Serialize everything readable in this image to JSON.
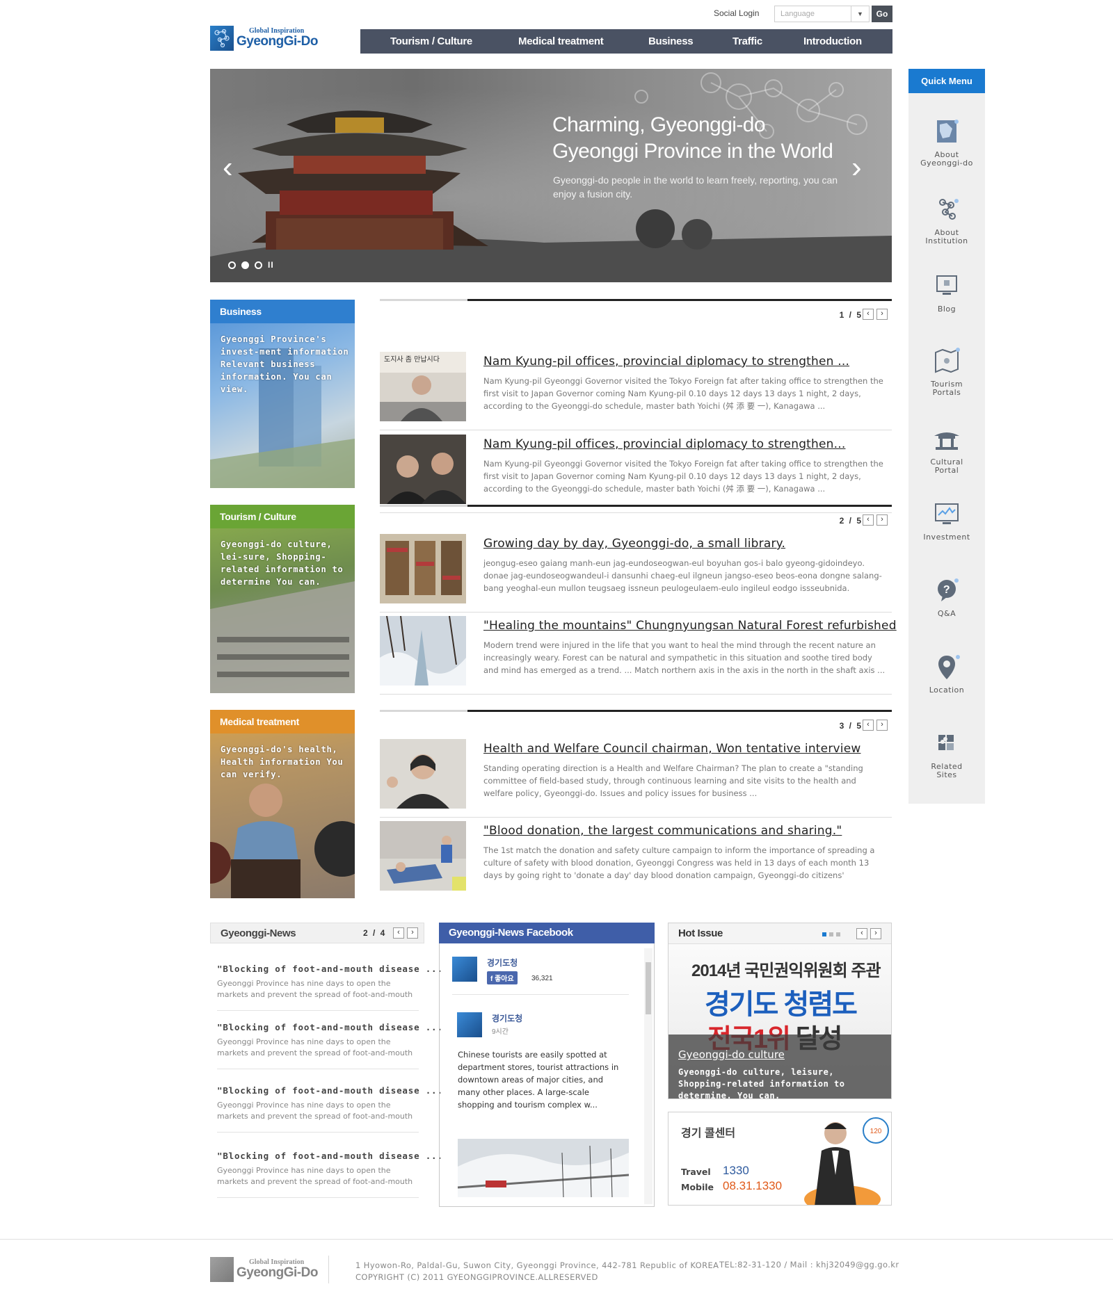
{
  "header": {
    "social_login": "Social Login",
    "language_placeholder": "Language",
    "go_label": "Go",
    "logo_tagline": "Global Inspiration",
    "logo_name": "GyeongGi-Do",
    "nav": [
      "Tourism / Culture",
      "Medical treatment",
      "Business",
      "Traffic",
      "Introduction"
    ]
  },
  "hero": {
    "title_line1": "Charming, Gyeonggi-do",
    "title_line2": "Gyeonggi Province in the World",
    "desc": "Gyeonggi-do people in the world to learn freely, reporting, you can enjoy a fusion city.",
    "slides": 3,
    "active_slide": 2,
    "prev_icon": "chevron-left-icon",
    "next_icon": "chevron-right-icon"
  },
  "quick_menu": {
    "title": "Quick Menu",
    "items": [
      {
        "label1": "About",
        "label2": "Gyeonggi-do",
        "icon": "map-icon"
      },
      {
        "label1": "About",
        "label2": "Institution",
        "icon": "institution-icon"
      },
      {
        "label1": "Blog",
        "label2": "",
        "icon": "monitor-icon"
      },
      {
        "label1": "Tourism",
        "label2": "Portals",
        "icon": "tourism-map-icon"
      },
      {
        "label1": "Cultural",
        "label2": "Portal",
        "icon": "palace-icon"
      },
      {
        "label1": "Investment",
        "label2": "",
        "icon": "chart-monitor-icon"
      },
      {
        "label1": "Q&A",
        "label2": "",
        "icon": "question-bubble-icon"
      },
      {
        "label1": "Location",
        "label2": "",
        "icon": "location-pin-icon"
      },
      {
        "label1": "Related",
        "label2": "Sites",
        "icon": "puzzle-icon"
      }
    ]
  },
  "categories": [
    {
      "title": "Business",
      "text": "Gyeonggi Province's invest-ment information Relevant business information. You can view.",
      "color": "#2f7fcf"
    },
    {
      "title": "Tourism / Culture",
      "text": "Gyeonggi-do culture, lei-sure, Shopping-related information to determine You can.",
      "color": "#5e9c2a"
    },
    {
      "title": "Medical treatment",
      "text": "Gyeonggi-do's health, Health information You can verify.",
      "color": "#e0902a"
    }
  ],
  "news_blocks": [
    {
      "page": "1 / 5",
      "articles": [
        {
          "title": "Nam Kyung-pil offices, provincial diplomacy to strengthen ...",
          "body": "Nam Kyung-pil Gyeonggi Governor visited the Tokyo Foreign fat after taking office to strengthen the first visit to Japan Governor coming Nam Kyung-pil 0.10 days 12 days 13 days 1 night, 2 days, according to the Gyeonggi-do schedule, master bath Yoichi (舛 添 要 一), Kanagawa ..."
        },
        {
          "title": "Nam Kyung-pil offices, provincial diplomacy to strengthen...",
          "body": "Nam Kyung-pil Gyeonggi Governor visited the Tokyo Foreign fat after taking office to strengthen the first visit to Japan Governor coming Nam Kyung-pil 0.10 days 12 days 13 days 1 night, 2 days, according to the Gyeonggi-do schedule, master bath Yoichi (舛 添 要 一), Kanagawa ..."
        }
      ]
    },
    {
      "page": "2 / 5",
      "articles": [
        {
          "title": "Growing day by day, Gyeonggi-do, a small library.",
          "body": "jeongug-eseo gaiang manh-eun jag-eundoseogwan-eul boyuhan gos-i balo gyeong-gidoindeyo. donae jag-eundoseogwandeul-i dansunhi chaeg-eul ilgneun jangso-eseo beos-eona dongne salang-bang yeoghal-eun mullon teugsaeg issneun peulogeulaem-eulo ingileul eodgo issseubnida. jeongug-"
        },
        {
          "title": "\"Healing the mountains\" Chungnyungsan Natural Forest refurbished",
          "body": "Modern trend were injured in the life that you want to heal the mind through the recent nature an increasingly weary. Forest can be natural and sympathetic in this situation and soothe tired body and mind has emerged as a trend. ... Match northern axis in the axis in the north in the shaft axis ... game"
        }
      ]
    },
    {
      "page": "3 / 5",
      "articles": [
        {
          "title": "Health and Welfare Council chairman, Won tentative interview",
          "body": "Standing operating direction is a Health and Welfare Chairman? The plan to create a \"standing committee of field-based study, through continuous learning and site visits to the health and welfare policy, Gyeonggi-do. Issues and policy issues for business ..."
        },
        {
          "title": "\"Blood donation, the largest communications and sharing.\"",
          "body": "The 1st match the donation and safety culture campaign to inform the importance of spreading a culture of safety with blood donation, Gyeonggi Congress was held in 13 days of each month 13 days by going right to 'donate a day' day blood donation campaign, Gyeonggi-do citizens' participation safety with"
        }
      ]
    }
  ],
  "gyeonggi_news": {
    "title": "Gyeonggi-News",
    "page": "2 / 4",
    "items": [
      {
        "title": "\"Blocking of foot-and-mouth disease ...",
        "l1": "Gyeonggi Province has nine days to open the",
        "l2": "markets and prevent the spread of foot-and-mouth"
      },
      {
        "title": "\"Blocking of foot-and-mouth disease ...",
        "l1": "Gyeonggi Province has nine days to open the",
        "l2": "markets and prevent the spread of foot-and-mouth"
      },
      {
        "title": "\"Blocking of foot-and-mouth disease ...",
        "l1": "Gyeonggi Province has nine days to open the",
        "l2": "markets and prevent the spread of foot-and-mouth"
      },
      {
        "title": "\"Blocking of foot-and-mouth disease ...",
        "l1": "Gyeonggi Province has nine days to open the",
        "l2": "markets and prevent the spread of foot-and-mouth"
      }
    ]
  },
  "facebook": {
    "title": "Gyeonggi-News Facebook",
    "page_name": "경기도청",
    "like_label": "좋아요",
    "like_count": "36,321",
    "post_author": "경기도청",
    "post_time": "9시간",
    "post_text": "Chinese tourists are easily spotted at department stores, tourist attractions in downtown areas of major cities, and many other places. A large-scale shopping and tourism complex w..."
  },
  "hot_issue": {
    "title": "Hot Issue",
    "img_line1": "2014년 국민권익위원회 주관",
    "img_line2": "경기도 청렴도",
    "img_line3a": "전국1위",
    "img_line3b": "달성",
    "caption_title": "Gyeonggi-do culture",
    "caption_text": "Gyeonggi-do culture, leisure, Shopping-related information to determine. You can."
  },
  "call_center": {
    "title": "경기 콜센터",
    "travel_label": "Travel",
    "travel_number": "1330",
    "mobile_label": "Mobile",
    "mobile_number": "08.31.1330",
    "badge": "120"
  },
  "footer": {
    "address": "1 Hyowon-Ro, Paldal-Gu, Suwon City, Gyeonggi Province, 442-781 Republic of KOREA",
    "copyright": "COPYRIGHT (C) 2011 GYEONGGIPROVINCE.ALLRESERVED",
    "contact": "TEL:82-31-120  /  Mail : khj32049@gg.go.kr"
  }
}
